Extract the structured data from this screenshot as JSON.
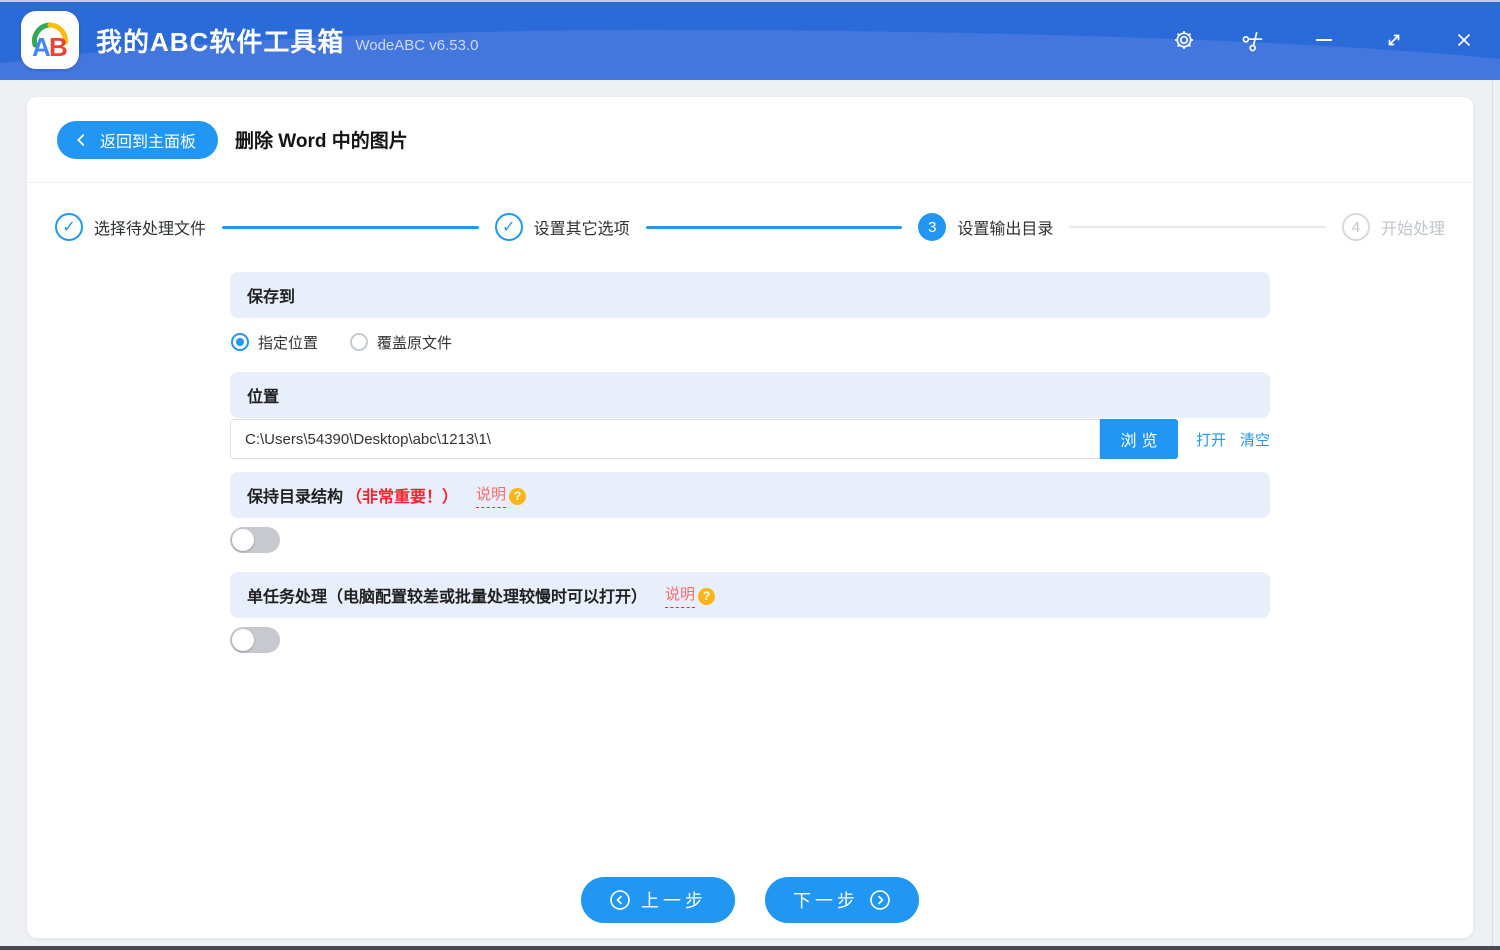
{
  "titlebar": {
    "app_title": "我的ABC软件工具箱",
    "version": "WodeABC v6.53.0",
    "logo_a": "A",
    "logo_b": "B"
  },
  "header": {
    "back_button": "返回到主面板",
    "page_title": "删除 Word 中的图片"
  },
  "steps": [
    {
      "label": "选择待处理文件",
      "state": "done",
      "mark": "✓"
    },
    {
      "label": "设置其它选项",
      "state": "done",
      "mark": "✓"
    },
    {
      "label": "设置输出目录",
      "state": "active",
      "number": "3"
    },
    {
      "label": "开始处理",
      "state": "pending",
      "number": "4"
    }
  ],
  "form": {
    "save_to": {
      "title": "保存到",
      "option_specified": "指定位置",
      "option_overwrite": "覆盖原文件",
      "selected": "指定位置"
    },
    "location": {
      "title": "位置",
      "path": "C:\\Users\\54390\\Desktop\\abc\\1213\\1\\",
      "browse_label": "浏览",
      "open_label": "打开",
      "clear_label": "清空"
    },
    "keep_structure": {
      "title": "保持目录结构",
      "important_note": "（非常重要！）",
      "help_label": "说明",
      "enabled": false
    },
    "single_task": {
      "title": "单任务处理（电脑配置较差或批量处理较慢时可以打开）",
      "help_label": "说明",
      "enabled": false
    }
  },
  "icons": {
    "question_mark": "?"
  },
  "footer": {
    "prev_label": "上一步",
    "next_label": "下一步"
  },
  "colors": {
    "titlebar_blue": "#2a6ad9",
    "titlebar_wave": "#4377dd",
    "accent_blue": "#2196f3",
    "section_bg": "#e9eefb",
    "important_red": "#f5222d",
    "help_icon_orange": "#fbb517"
  }
}
